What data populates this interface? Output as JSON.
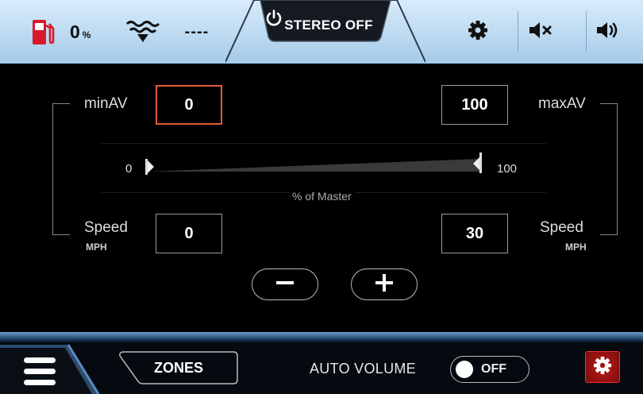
{
  "topbar": {
    "fuel_value": "0",
    "fuel_unit": "%",
    "depth_value": "----",
    "stereo_label": "STEREO OFF",
    "icons": [
      "fuel-icon",
      "depth-icon",
      "power-icon",
      "gear-icon",
      "mute-icon",
      "volume-up-icon"
    ]
  },
  "main": {
    "minav_label": "minAV",
    "maxav_label": "maxAV",
    "minav_value": "0",
    "maxav_value": "100",
    "slider_min_label": "0",
    "slider_max_label": "100",
    "slider_caption": "% of Master",
    "speed_left_label": "Speed",
    "speed_right_label": "Speed",
    "speed_unit_left": "MPH",
    "speed_unit_right": "MPH",
    "speed_min_value": "0",
    "speed_max_value": "30",
    "minus_label": "minus-icon",
    "plus_label": "plus-icon"
  },
  "bottombar": {
    "zones_label": "ZONES",
    "auto_volume_label": "AUTO VOLUME",
    "toggle_state": "OFF",
    "icons": [
      "menu-icon",
      "gear-icon"
    ]
  },
  "colors": {
    "topbar_bg": "#bcdaf2",
    "active_border": "#e2593a",
    "fuel_red": "#d8192d",
    "settings_red": "#b3121b"
  }
}
